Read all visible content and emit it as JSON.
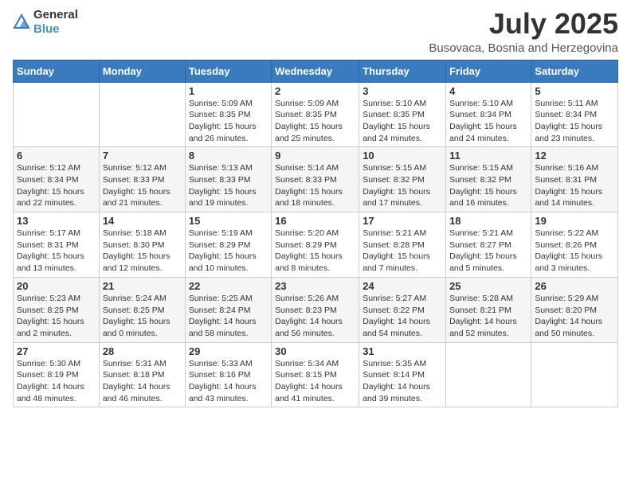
{
  "logo": {
    "general": "General",
    "blue": "Blue"
  },
  "header": {
    "month": "July 2025",
    "location": "Busovaca, Bosnia and Herzegovina"
  },
  "weekdays": [
    "Sunday",
    "Monday",
    "Tuesday",
    "Wednesday",
    "Thursday",
    "Friday",
    "Saturday"
  ],
  "weeks": [
    [
      {
        "day": "",
        "info": ""
      },
      {
        "day": "",
        "info": ""
      },
      {
        "day": "1",
        "info": "Sunrise: 5:09 AM\nSunset: 8:35 PM\nDaylight: 15 hours\nand 26 minutes."
      },
      {
        "day": "2",
        "info": "Sunrise: 5:09 AM\nSunset: 8:35 PM\nDaylight: 15 hours\nand 25 minutes."
      },
      {
        "day": "3",
        "info": "Sunrise: 5:10 AM\nSunset: 8:35 PM\nDaylight: 15 hours\nand 24 minutes."
      },
      {
        "day": "4",
        "info": "Sunrise: 5:10 AM\nSunset: 8:34 PM\nDaylight: 15 hours\nand 24 minutes."
      },
      {
        "day": "5",
        "info": "Sunrise: 5:11 AM\nSunset: 8:34 PM\nDaylight: 15 hours\nand 23 minutes."
      }
    ],
    [
      {
        "day": "6",
        "info": "Sunrise: 5:12 AM\nSunset: 8:34 PM\nDaylight: 15 hours\nand 22 minutes."
      },
      {
        "day": "7",
        "info": "Sunrise: 5:12 AM\nSunset: 8:33 PM\nDaylight: 15 hours\nand 21 minutes."
      },
      {
        "day": "8",
        "info": "Sunrise: 5:13 AM\nSunset: 8:33 PM\nDaylight: 15 hours\nand 19 minutes."
      },
      {
        "day": "9",
        "info": "Sunrise: 5:14 AM\nSunset: 8:33 PM\nDaylight: 15 hours\nand 18 minutes."
      },
      {
        "day": "10",
        "info": "Sunrise: 5:15 AM\nSunset: 8:32 PM\nDaylight: 15 hours\nand 17 minutes."
      },
      {
        "day": "11",
        "info": "Sunrise: 5:15 AM\nSunset: 8:32 PM\nDaylight: 15 hours\nand 16 minutes."
      },
      {
        "day": "12",
        "info": "Sunrise: 5:16 AM\nSunset: 8:31 PM\nDaylight: 15 hours\nand 14 minutes."
      }
    ],
    [
      {
        "day": "13",
        "info": "Sunrise: 5:17 AM\nSunset: 8:31 PM\nDaylight: 15 hours\nand 13 minutes."
      },
      {
        "day": "14",
        "info": "Sunrise: 5:18 AM\nSunset: 8:30 PM\nDaylight: 15 hours\nand 12 minutes."
      },
      {
        "day": "15",
        "info": "Sunrise: 5:19 AM\nSunset: 8:29 PM\nDaylight: 15 hours\nand 10 minutes."
      },
      {
        "day": "16",
        "info": "Sunrise: 5:20 AM\nSunset: 8:29 PM\nDaylight: 15 hours\nand 8 minutes."
      },
      {
        "day": "17",
        "info": "Sunrise: 5:21 AM\nSunset: 8:28 PM\nDaylight: 15 hours\nand 7 minutes."
      },
      {
        "day": "18",
        "info": "Sunrise: 5:21 AM\nSunset: 8:27 PM\nDaylight: 15 hours\nand 5 minutes."
      },
      {
        "day": "19",
        "info": "Sunrise: 5:22 AM\nSunset: 8:26 PM\nDaylight: 15 hours\nand 3 minutes."
      }
    ],
    [
      {
        "day": "20",
        "info": "Sunrise: 5:23 AM\nSunset: 8:25 PM\nDaylight: 15 hours\nand 2 minutes."
      },
      {
        "day": "21",
        "info": "Sunrise: 5:24 AM\nSunset: 8:25 PM\nDaylight: 15 hours\nand 0 minutes."
      },
      {
        "day": "22",
        "info": "Sunrise: 5:25 AM\nSunset: 8:24 PM\nDaylight: 14 hours\nand 58 minutes."
      },
      {
        "day": "23",
        "info": "Sunrise: 5:26 AM\nSunset: 8:23 PM\nDaylight: 14 hours\nand 56 minutes."
      },
      {
        "day": "24",
        "info": "Sunrise: 5:27 AM\nSunset: 8:22 PM\nDaylight: 14 hours\nand 54 minutes."
      },
      {
        "day": "25",
        "info": "Sunrise: 5:28 AM\nSunset: 8:21 PM\nDaylight: 14 hours\nand 52 minutes."
      },
      {
        "day": "26",
        "info": "Sunrise: 5:29 AM\nSunset: 8:20 PM\nDaylight: 14 hours\nand 50 minutes."
      }
    ],
    [
      {
        "day": "27",
        "info": "Sunrise: 5:30 AM\nSunset: 8:19 PM\nDaylight: 14 hours\nand 48 minutes."
      },
      {
        "day": "28",
        "info": "Sunrise: 5:31 AM\nSunset: 8:18 PM\nDaylight: 14 hours\nand 46 minutes."
      },
      {
        "day": "29",
        "info": "Sunrise: 5:33 AM\nSunset: 8:16 PM\nDaylight: 14 hours\nand 43 minutes."
      },
      {
        "day": "30",
        "info": "Sunrise: 5:34 AM\nSunset: 8:15 PM\nDaylight: 14 hours\nand 41 minutes."
      },
      {
        "day": "31",
        "info": "Sunrise: 5:35 AM\nSunset: 8:14 PM\nDaylight: 14 hours\nand 39 minutes."
      },
      {
        "day": "",
        "info": ""
      },
      {
        "day": "",
        "info": ""
      }
    ]
  ]
}
